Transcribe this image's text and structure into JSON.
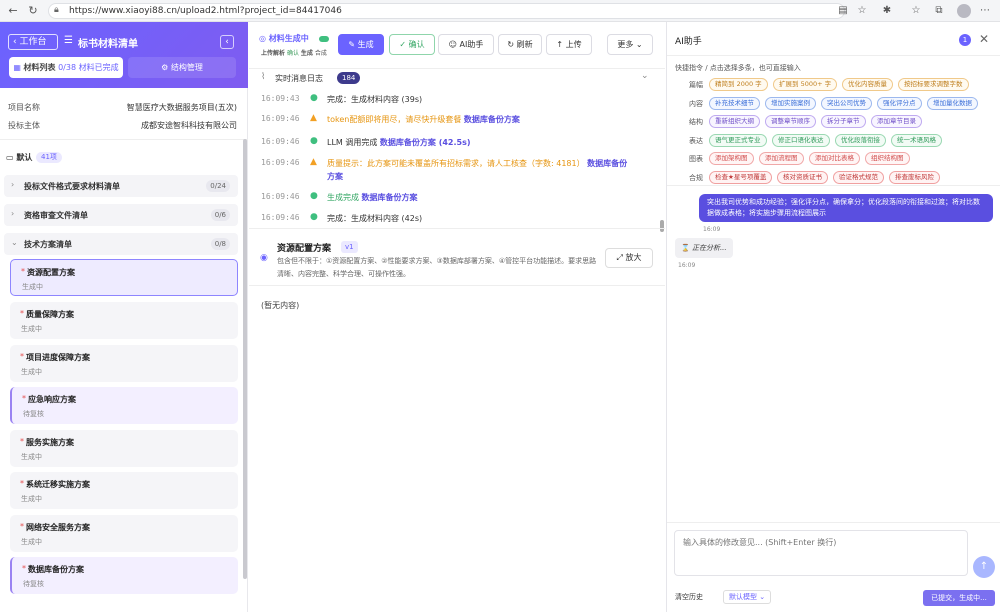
{
  "browser": {
    "url": "https://www.xiaoyi88.cn/upload2.html?project_id=84417046",
    "icons": [
      "back-icon",
      "refresh-icon",
      "lock-icon",
      "reader-icon",
      "star-icon",
      "extensions-icon",
      "favorites-icon",
      "collections-icon",
      "avatar",
      "more-icon"
    ]
  },
  "left": {
    "back_label": "工作台",
    "title": "标书材料清单",
    "tab_list_prefix": "材料列表",
    "tab_list_count": "0/38 材料已完成",
    "tab_structure": "结构管理",
    "info": [
      {
        "label": "项目名称",
        "value": "智慧医疗大数据服务项目(五次)"
      },
      {
        "label": "投标主体",
        "value": "成都安途智科科技有限公司"
      }
    ],
    "default_label": "默认",
    "default_count": "41项",
    "groups": [
      {
        "label": "投标文件格式要求材料清单",
        "count": "0/24"
      },
      {
        "label": "资格审查文件清单",
        "count": "0/6"
      },
      {
        "label": "技术方案清单",
        "count": "0/8"
      }
    ],
    "items": [
      {
        "label": "资源配置方案",
        "status": "生成中"
      },
      {
        "label": "质量保障方案",
        "status": "生成中"
      },
      {
        "label": "项目进度保障方案",
        "status": "生成中"
      },
      {
        "label": "应急响应方案",
        "status": "待复核"
      },
      {
        "label": "服务实施方案",
        "status": "生成中"
      },
      {
        "label": "系统迁移实施方案",
        "status": "生成中"
      },
      {
        "label": "网络安全服务方案",
        "status": "生成中"
      },
      {
        "label": "数据库备份方案",
        "status": "待复核"
      }
    ]
  },
  "mid": {
    "status_label": "材料生成中",
    "status_sub_1": "上传解析",
    "status_sub_2": "确认",
    "status_sub_3": "生成",
    "status_sub_4": "合成",
    "buttons": {
      "generate": "生成",
      "confirm": "确认",
      "ai": "AI助手",
      "refresh": "刷新",
      "upload": "上传",
      "more": "更多"
    },
    "log_title": "实时消息日志",
    "log_count": "184",
    "logs": [
      {
        "time": "16:09:43",
        "type": "ok",
        "text": "完成：生成材料内容 (39s)",
        "link": ""
      },
      {
        "time": "16:09:46",
        "type": "warn",
        "text": "token配额即将用尽，请尽快升级套餐",
        "link": "数据库备份方案"
      },
      {
        "time": "16:09:46",
        "type": "ok",
        "text": "LLM 调用完成",
        "link": "数据库备份方案 (42.5s)"
      },
      {
        "time": "16:09:46",
        "type": "warn",
        "text": "质量提示：此方案可能未覆盖所有招标需求，请人工核查（字数: 4181）",
        "link": "数据库备份",
        "link2": "方案"
      },
      {
        "time": "16:09:46",
        "type": "ok",
        "text": "生成完成",
        "link": "数据库备份方案"
      },
      {
        "time": "16:09:46",
        "type": "ok",
        "text": "完成：生成材料内容 (42s)",
        "link": ""
      }
    ],
    "section_title": "资源配置方案",
    "section_version": "v1",
    "section_desc": "包含但不限于：①资源配置方案、②性能要求方案、③数据库部署方案、④管控平台功能描述。要求思路清晰、内容完整、科学合理、可操作性强。",
    "zoom_label": "放大",
    "empty_label": "(暂无内容)"
  },
  "right": {
    "title": "AI助手",
    "badge": "1",
    "quick_hint": "快捷指令 / 点击选择多条，也可直接输入",
    "categories": [
      {
        "name": "篇幅",
        "style": "o",
        "chips": [
          "精简到 2000 字",
          "扩展到 5000+ 字",
          "优化内容质量",
          "按招标要求调整字数"
        ]
      },
      {
        "name": "内容",
        "style": "b",
        "chips": [
          "补充技术细节",
          "增加实施案例",
          "突出公司优势",
          "强化评分点",
          "增加量化数据"
        ]
      },
      {
        "name": "结构",
        "style": "p",
        "chips": [
          "重新组织大纲",
          "调整章节顺序",
          "拆分子章节",
          "添加章节目录"
        ]
      },
      {
        "name": "表达",
        "style": "g",
        "chips": [
          "语气更正式专业",
          "修正口语化表达",
          "优化段落衔接",
          "统一术语风格"
        ]
      },
      {
        "name": "图表",
        "style": "r",
        "chips": [
          "添加架构图",
          "添加流程图",
          "添加对比表格",
          "组织结构图"
        ]
      },
      {
        "name": "合规",
        "style": "d",
        "chips": [
          "检查★星号项覆盖",
          "核对资质证书",
          "验证格式规范",
          "排查废标风险"
        ]
      }
    ],
    "user_message": "突出我司优势和成功经验；强化评分点，确保拿分；优化段落间的衔接和过渡；将对比数据做成表格；将实施步骤用流程图展示",
    "user_time": "16:09",
    "ai_message": "正在分析...",
    "ai_time": "16:09",
    "input_placeholder": "输入具体的修改意见... (Shift+Enter 换行)",
    "clear_label": "清空历史",
    "model_label": "默认模型",
    "submit_label": "已提交，生成中..."
  }
}
